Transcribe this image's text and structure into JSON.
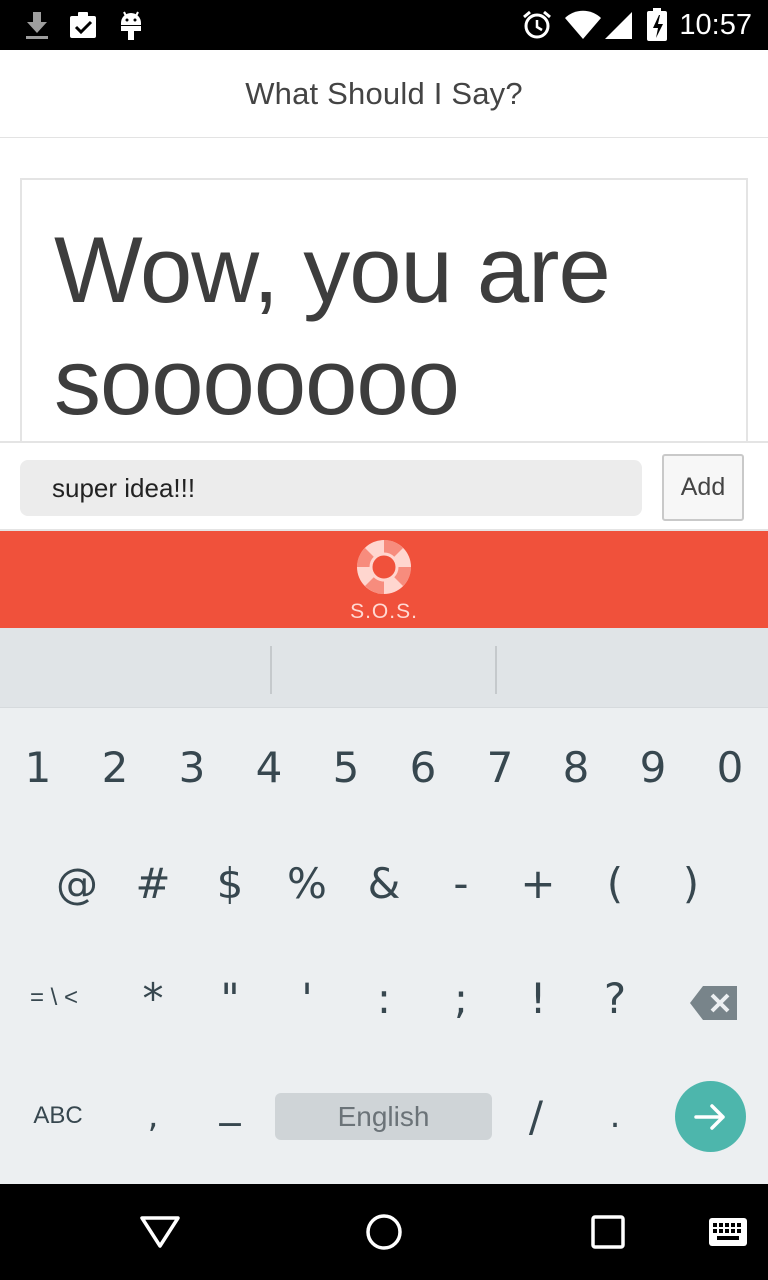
{
  "status_bar": {
    "time": "10:57",
    "icons": [
      "download-icon",
      "clipboard-check-icon",
      "android-icon",
      "alarm-icon",
      "wifi-icon",
      "signal-icon",
      "battery-charging-icon"
    ]
  },
  "app": {
    "title": "What Should I Say?"
  },
  "message": {
    "text": "Wow, you are sooooooo"
  },
  "input": {
    "value": "super idea!!!",
    "add_label": "Add"
  },
  "sos": {
    "label": "S.O.S.",
    "icon": "lifebuoy-icon",
    "color": "#f0513b"
  },
  "keyboard": {
    "row1": [
      "1",
      "2",
      "3",
      "4",
      "5",
      "6",
      "7",
      "8",
      "9",
      "0"
    ],
    "row2": [
      "@",
      "#",
      "$",
      "%",
      "&",
      "-",
      "+",
      "(",
      ")"
    ],
    "row3": [
      "= \\ <",
      "*",
      "\"",
      "'",
      ":",
      ";",
      "!",
      "?"
    ],
    "abc_label": "ABC",
    "comma": ",",
    "underscore": "_",
    "space_label": "English",
    "slash": "/",
    "period": ".",
    "enter_color": "#4db6ac"
  },
  "nav_bar": {
    "icons": [
      "back-icon",
      "home-icon",
      "recents-icon",
      "keyboard-icon"
    ]
  }
}
